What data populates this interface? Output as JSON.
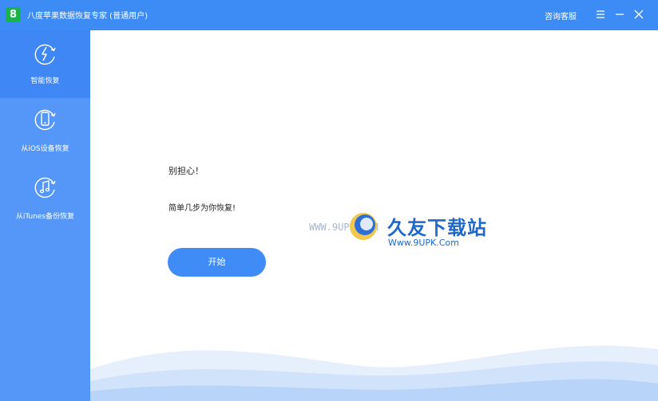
{
  "window": {
    "logo_glyph": "8",
    "title": "八度苹果数据恢复专家  (普通用户)",
    "support_label": "咨询客服",
    "accent_color": "#3d8bf5",
    "controls": [
      "menu-icon",
      "minimize-icon",
      "close-icon"
    ]
  },
  "sidebar": {
    "items": [
      {
        "label": "智能恢复",
        "icon": "lightning-refresh-icon",
        "active": true
      },
      {
        "label": "从iOS设备恢复",
        "icon": "phone-refresh-icon",
        "active": false
      },
      {
        "label": "从iTunes备份恢复",
        "icon": "music-refresh-icon",
        "active": false
      }
    ]
  },
  "main": {
    "headline": "别担心！",
    "subline": "简单几步为你恢复!",
    "start_label": "开始",
    "button_color": "#3f8cf6"
  },
  "watermark": {
    "site_small": "WWW.9UPK.COM",
    "brand": "久友下载站",
    "url": "Www.9UPK.Com"
  }
}
